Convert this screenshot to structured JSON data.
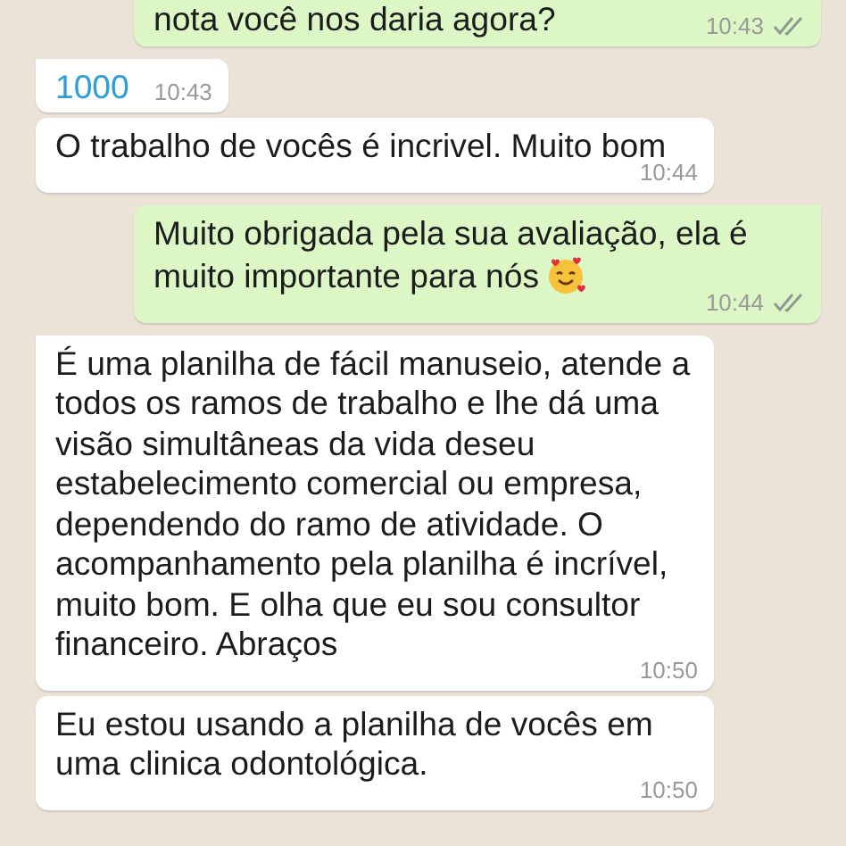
{
  "messages": [
    {
      "outgoing": true,
      "tail": false,
      "text": "nota você nos daria agora?",
      "time": "10:43",
      "read": false,
      "link": false,
      "emoji": false
    },
    {
      "outgoing": false,
      "tail": true,
      "text": "1000",
      "time": "10:43",
      "link": true,
      "emoji": false
    },
    {
      "outgoing": false,
      "tail": false,
      "text": "O trabalho de vocês é incrivel. Muito bom",
      "time": "10:44",
      "link": false,
      "emoji": false
    },
    {
      "outgoing": true,
      "tail": true,
      "text": "Muito obrigada pela sua avaliação, ela é muito importante para nós",
      "time": "10:44",
      "read": false,
      "link": false,
      "emoji": true
    },
    {
      "outgoing": false,
      "tail": true,
      "text": "É uma planilha de fácil manuseio, atende a todos os ramos de trabalho e lhe dá uma visão simultâneas da vida deseu estabelecimento comercial ou empresa, dependendo do ramo de atividade. O acompanhamento pela planilha é incrível, muito bom. E olha que eu sou consultor financeiro. Abraços",
      "time": "10:50",
      "link": false,
      "emoji": false
    },
    {
      "outgoing": false,
      "tail": false,
      "text": "Eu estou usando a planilha de vocês em uma clinica odontológica.",
      "time": "10:50",
      "link": false,
      "emoji": false
    }
  ]
}
